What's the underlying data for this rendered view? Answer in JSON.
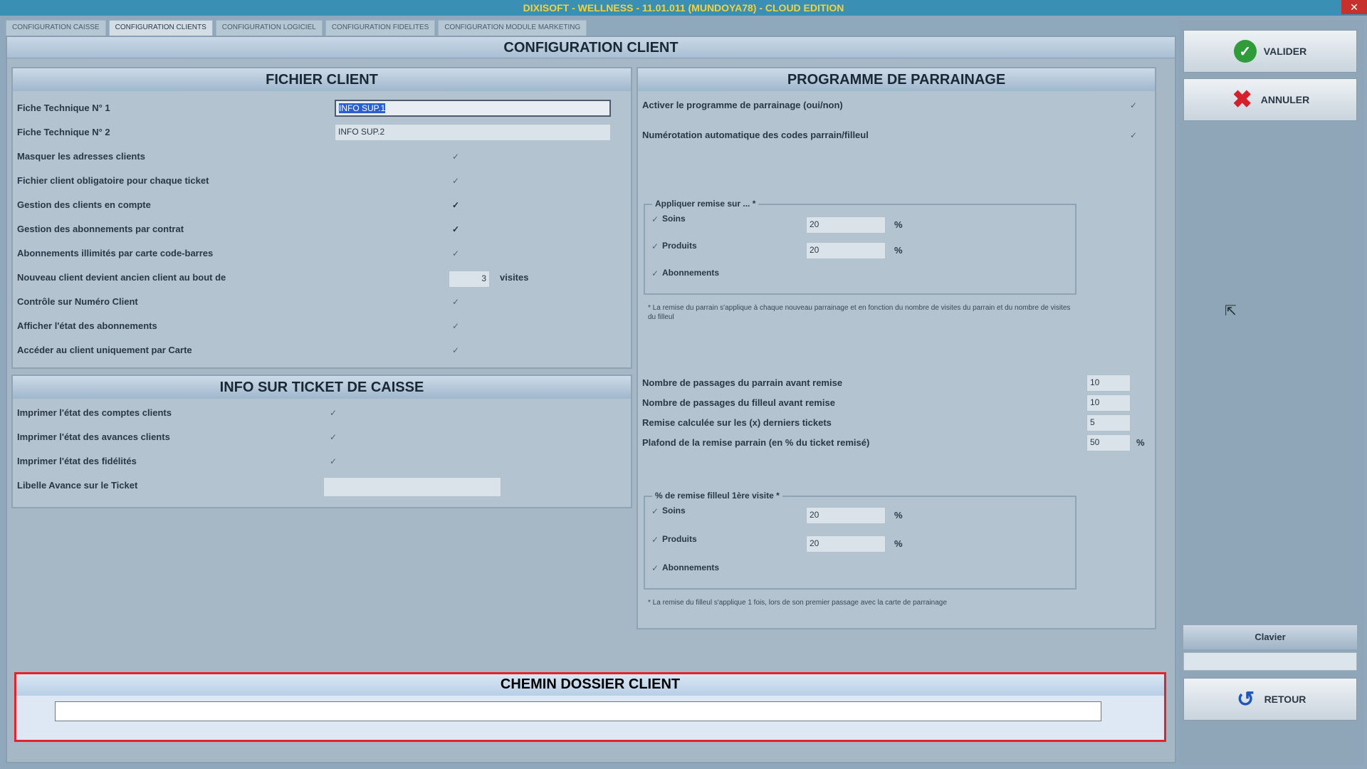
{
  "window": {
    "title": "DIXISOFT - WELLNESS - 11.01.011 (MUNDOYA78) - CLOUD EDITION",
    "close_label": "✕"
  },
  "tabs": [
    {
      "label": "CONFIGURATION CAISSE",
      "active": false
    },
    {
      "label": "CONFIGURATION CLIENTS",
      "active": true
    },
    {
      "label": "CONFIGURATION LOGICIEL",
      "active": false
    },
    {
      "label": "CONFIGURATION FIDELITES",
      "active": false
    },
    {
      "label": "CONFIGURATION MODULE MARKETING",
      "active": false
    }
  ],
  "main": {
    "title": "CONFIGURATION CLIENT"
  },
  "fichier_client": {
    "title": "FICHIER CLIENT",
    "fiche1_label": "Fiche Technique N° 1",
    "fiche1_value": "INFO SUP.1",
    "fiche2_label": "Fiche Technique N° 2",
    "fiche2_value": "INFO SUP.2",
    "masquer_label": "Masquer les adresses clients",
    "obligatoire_label": "Fichier client obligatoire pour chaque ticket",
    "gestion_compte_label": "Gestion des clients en compte",
    "gestion_abonnements_label": "Gestion des abonnements par contrat",
    "abonnements_illimites_label": "Abonnements illimités par carte code-barres",
    "nouveau_client_label": "Nouveau client devient ancien client au bout de",
    "nouveau_client_value": "3",
    "visites_label": "visites",
    "controle_label": "Contrôle sur Numéro Client",
    "afficher_label": "Afficher l'état des abonnements",
    "acceder_label": "Accéder au  client uniquement par Carte",
    "checks": {
      "masquer": false,
      "obligatoire": false,
      "gestion_compte": true,
      "gestion_abonnements": true,
      "abonnements_illimites": false,
      "controle": false,
      "afficher": false,
      "acceder": false
    }
  },
  "ticket": {
    "title": "INFO SUR TICKET DE CAISSE",
    "comptes_label": "Imprimer l'état des comptes clients",
    "avances_label": "Imprimer l'état des avances clients",
    "fidelites_label": "Imprimer l'état des fidélités",
    "libelle_label": "Libelle Avance sur le Ticket",
    "libelle_value": ""
  },
  "parrainage": {
    "title": "PROGRAMME DE PARRAINAGE",
    "activer_label": "Activer le programme de parrainage (oui/non)",
    "numerotation_label": "Numérotation automatique des codes parrain/filleul",
    "remise_group_label": "Appliquer remise sur ... *",
    "soins_label": "Soins",
    "soins_value": "20",
    "produits_label": "Produits",
    "produits_value": "20",
    "abonnements_label": "Abonnements",
    "percent": "%",
    "note1": "* La remise du parrain s'applique à chaque nouveau parrainage et en fonction du nombre de visites du parrain et du nombre de visites du filleul",
    "passages_parrain_label": "Nombre de passages du parrain avant remise",
    "passages_parrain_value": "10",
    "passages_filleul_label": "Nombre de passages du filleul avant remise",
    "passages_filleul_value": "10",
    "remise_calculee_label": "Remise calculée sur les (x) derniers tickets",
    "remise_calculee_value": "5",
    "plafond_label": "Plafond de la remise parrain (en % du ticket remisé)",
    "plafond_value": "50",
    "filleul_group_label": "% de remise filleul 1ère visite *",
    "filleul_soins_value": "20",
    "filleul_produits_value": "20",
    "note2": "* La remise du filleul s'applique 1 fois, lors de son premier passage avec la carte de parrainage"
  },
  "chemin": {
    "title": "CHEMIN DOSSIER CLIENT",
    "value": ""
  },
  "side": {
    "valider_label": "VALIDER",
    "annuler_label": "ANNULER",
    "clavier_label": "Clavier",
    "retour_label": "RETOUR"
  }
}
